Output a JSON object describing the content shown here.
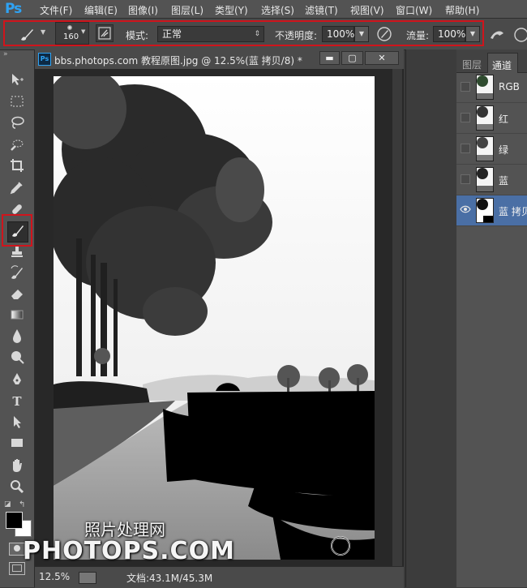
{
  "app": {
    "logo": "Ps"
  },
  "menu": [
    "文件(F)",
    "编辑(E)",
    "图像(I)",
    "图层(L)",
    "类型(Y)",
    "选择(S)",
    "滤镜(T)",
    "视图(V)",
    "窗口(W)",
    "帮助(H)"
  ],
  "options": {
    "brush_size": "160",
    "mode_label": "模式:",
    "mode_value": "正常",
    "opacity_label": "不透明度:",
    "opacity_value": "100%",
    "flow_label": "流量:",
    "flow_value": "100%"
  },
  "document": {
    "title": "bbs.photops.com 教程原图.jpg @ 12.5%(蓝 拷贝/8) *",
    "title_icon": "Ps",
    "zoom": "12.5%",
    "doc_size": "文档:43.1M/45.3M"
  },
  "channels": {
    "tabs": [
      "图层",
      "通道"
    ],
    "active_tab": "通道",
    "rows": [
      {
        "name": "RGB"
      },
      {
        "name": "红"
      },
      {
        "name": "绿"
      },
      {
        "name": "蓝"
      },
      {
        "name": "蓝 拷贝"
      }
    ]
  },
  "watermark": {
    "line1": "照片处理网",
    "line2": "PHOTOPS.COM"
  },
  "colors": {
    "accent_red": "#d0141c",
    "ps_blue": "#2fa3f4",
    "selected_row": "#4a6fa5"
  }
}
